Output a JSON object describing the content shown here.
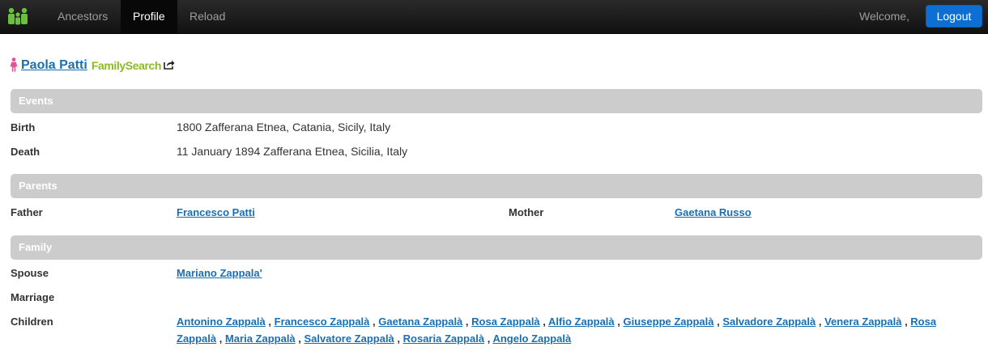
{
  "nav": {
    "ancestors": "Ancestors",
    "profile": "Profile",
    "reload": "Reload",
    "welcome": "Welcome,",
    "logout": "Logout"
  },
  "person": {
    "name": "Paola Patti",
    "source": "FamilySearch",
    "gender_icon": "female-person-icon"
  },
  "sections": {
    "events": "Events",
    "parents": "Parents",
    "family": "Family"
  },
  "events": {
    "birth_label": "Birth",
    "birth_value": "1800 Zafferana Etnea, Catania, Sicily, Italy",
    "death_label": "Death",
    "death_value": "11 January 1894 Zafferana Etnea, Sicilia, Italy"
  },
  "parents": {
    "father_label": "Father",
    "father_name": "Francesco Patti",
    "mother_label": "Mother",
    "mother_name": "Gaetana Russo"
  },
  "family": {
    "spouse_label": "Spouse",
    "spouse_name": "Mariano Zappala'",
    "marriage_label": "Marriage",
    "children_label": "Children",
    "children": [
      "Antonino Zappalà",
      "Francesco Zappalà",
      "Gaetana Zappalà",
      "Rosa Zappalà",
      "Alfio Zappalà",
      "Giuseppe Zappalà",
      "Salvadore Zappalà",
      "Venera Zappalà",
      "Rosa Zappalà",
      "Maria Zappalà",
      "Salvatore Zappalà",
      "Rosaria Zappalà",
      "Angelo Zappalà"
    ]
  },
  "colors": {
    "link": "#1a6fb3",
    "logout_bg": "#0e6fd3",
    "section_bg": "#cccccc",
    "brand_green": "#6abf3c",
    "familysearch_green": "#8cb82b",
    "female_icon": "#e0559a"
  }
}
